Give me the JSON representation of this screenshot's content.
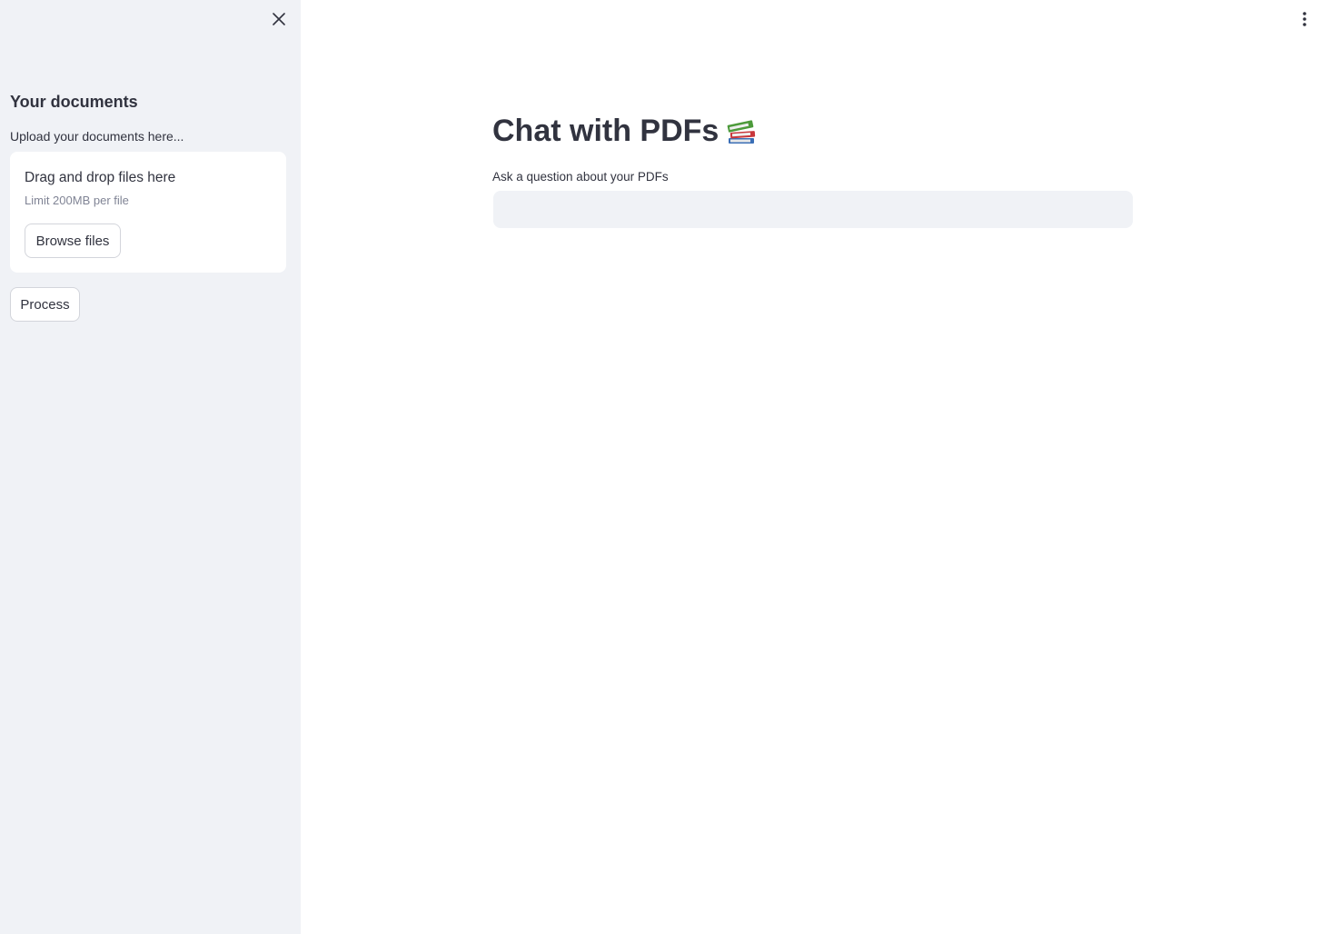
{
  "sidebar": {
    "close_icon": "close-icon",
    "title": "Your documents",
    "upload_label": "Upload your documents here...",
    "dropzone": {
      "title": "Drag and drop files here",
      "limit": "Limit 200MB per file",
      "browse_label": "Browse files"
    },
    "process_label": "Process",
    "background": "#f0f2f6"
  },
  "header": {
    "menu_icon": "kebab-menu-icon"
  },
  "main": {
    "title": "Chat with PDFs",
    "title_icon": "books-icon",
    "question_label": "Ask a question about your PDFs",
    "question_value": "",
    "question_placeholder": ""
  }
}
